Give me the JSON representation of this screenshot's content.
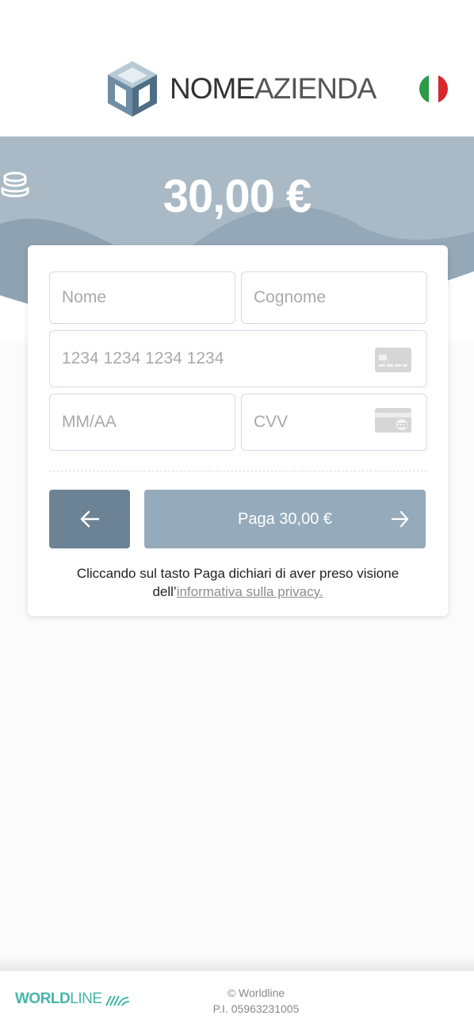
{
  "header": {
    "brand_name_bold": "NOME",
    "brand_name_light": "AZIENDA",
    "language_flag": "italy-flag"
  },
  "payment": {
    "amount": "30,00 €",
    "coins_icon": "coins-icon"
  },
  "form": {
    "first_name": {
      "placeholder": "Nome",
      "value": ""
    },
    "last_name": {
      "placeholder": "Cognome",
      "value": ""
    },
    "card_number": {
      "placeholder": "1234 1234 1234 1234",
      "value": ""
    },
    "expiry": {
      "placeholder": "MM/AA",
      "value": ""
    },
    "cvv": {
      "placeholder": "CVV",
      "value": "",
      "icon_hint": "123"
    },
    "back_icon": "arrow-left-icon",
    "pay_label": "Paga 30,00 €",
    "pay_icon": "arrow-right-icon"
  },
  "privacy": {
    "text_before": "Cliccando sul tasto Paga dichiari di aver preso visione",
    "text_line2": "dell’",
    "link_text": "informativa sulla privacy."
  },
  "footer": {
    "logo_bold": "WORLD",
    "logo_light": "LINE",
    "copyright": "© Worldline",
    "vat": "P.I. 05963231005"
  },
  "colors": {
    "hero": "#a9bac6",
    "back_button": "#6c8396",
    "pay_button": "#95abbb",
    "worldline_green": "#43b7a8"
  }
}
